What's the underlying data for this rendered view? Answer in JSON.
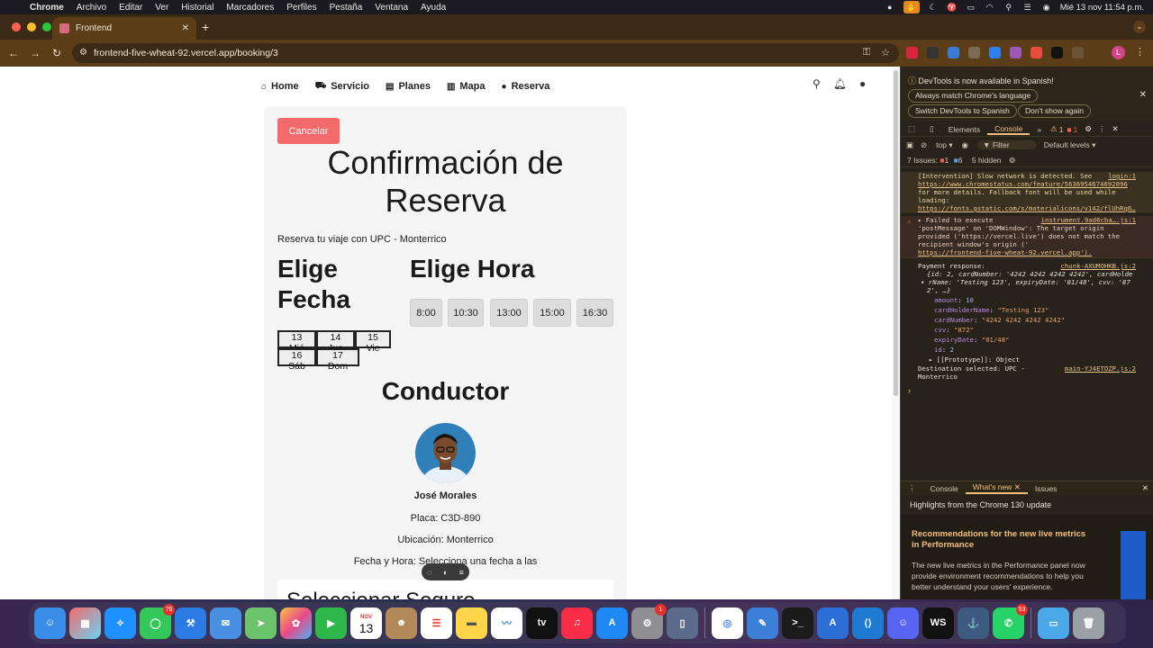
{
  "menubar": {
    "items": [
      "Chrome",
      "Archivo",
      "Editar",
      "Ver",
      "Historial",
      "Marcadores",
      "Perfiles",
      "Pestaña",
      "Ventana",
      "Ayuda"
    ],
    "datetime": "Mié 13 nov 11:54 p.m."
  },
  "browser": {
    "tab_title": "Frontend",
    "url": "frontend-five-wheat-92.vercel.app/booking/3",
    "profile_initial": "L"
  },
  "site_nav": {
    "items": [
      "Home",
      "Servicio",
      "Planes",
      "Mapa",
      "Reserva"
    ]
  },
  "booking": {
    "cancel_label": "Cancelar",
    "title": "Confirmación de Reserva",
    "subtitle": "Reserva tu viaje con UPC - Monterrico",
    "date_heading": "Elige Fecha",
    "time_heading": "Elige Hora",
    "dates": [
      "13 Mié",
      "14 Jue",
      "15 Vie",
      "16 Sáb",
      "17 Dom"
    ],
    "times": [
      "8:00",
      "10:30",
      "13:00",
      "15:00",
      "16:30"
    ],
    "driver_heading": "Conductor",
    "driver_name": "José Morales",
    "plate": "Placa: C3D-890",
    "location": "Ubicación: Monterrico",
    "datetime_line": "Fecha y Hora: Selecciona una fecha a las",
    "insurance_heading": "Seleccionar Seguro"
  },
  "devtools": {
    "notice": "DevTools is now available in Spanish!",
    "notice_buttons": [
      "Always match Chrome's language",
      "Switch DevTools to Spanish",
      "Don't show again"
    ],
    "tabs": [
      "Elements",
      "Console"
    ],
    "warn_count": "1",
    "err_count": "1",
    "context": "top",
    "filter_placeholder": "Filter",
    "levels": "Default levels",
    "issues_label": "7 Issues:",
    "issues_err": "1",
    "issues_info": "6",
    "hidden": "5 hidden",
    "log_intervention": "[Intervention] Slow network is detected. See",
    "log_intervention_link": "https://www.chromestatus.com/feature/5636954674692096",
    "log_intervention_rest": "for more details. Fallback font will be used while loading:",
    "log_intervention_font": "https://fonts.gstatic.com/s/materialicons/v142/flUhRq6…",
    "log_intervention_src": "login:1",
    "log_error_1": "▸ Failed to execute",
    "log_error_2": "'postMessage' on 'DOMWindow': The target origin",
    "log_error_3": "provided ('https://vercel.live') does not match the",
    "log_error_4": "recipient window's origin ('",
    "log_error_5": "https://frontend-five-wheat-92.vercel.app').",
    "log_error_src": "instrument.9ad6cba….js:1",
    "payment_label": "Payment response:",
    "payment_src": "chunk-AXUMOHKB.js:2",
    "payment_preview_1": "{id: 2, cardNumber: '4242 4242 4242 4242', cardHolde",
    "payment_preview_2": "rName: 'Testing 123', expiryDate: '01/48', cvv: '87",
    "payment_preview_3": "2', …}",
    "payment_fields": [
      {
        "key": "amount",
        "value": "10"
      },
      {
        "key": "cardHolderName",
        "value": "\"Testing 123\""
      },
      {
        "key": "cardNumber",
        "value": "\"4242 4242 4242 4242\""
      },
      {
        "key": "cvv",
        "value": "\"872\""
      },
      {
        "key": "expiryDate",
        "value": "\"01/48\""
      },
      {
        "key": "id",
        "value": "2"
      }
    ],
    "prototype": "[[Prototype]]: Object",
    "destination_1": "Destination selected: UPC -",
    "destination_2": "Monterrico",
    "destination_src": "main-YJ4ETOZP.js:2",
    "drawer_tabs": [
      "Console",
      "What's new",
      "Issues"
    ],
    "highlights": "Highlights from the Chrome 130 update",
    "wn_title": "Recommendations for the new live metrics in Performance",
    "wn_body": "The new live metrics in the Performance panel now provide environment recommendations to help you better understand your users' experience."
  },
  "dock": {
    "messages_badge": "76",
    "settings_badge": "1",
    "calendar_month": "NOV",
    "calendar_day": "13",
    "whatsapp_badge": "53"
  },
  "colors": {
    "cancel": "#f46a6a",
    "devtools_accent": "#f2c07a",
    "chrome_frame": "#5b3e17"
  }
}
